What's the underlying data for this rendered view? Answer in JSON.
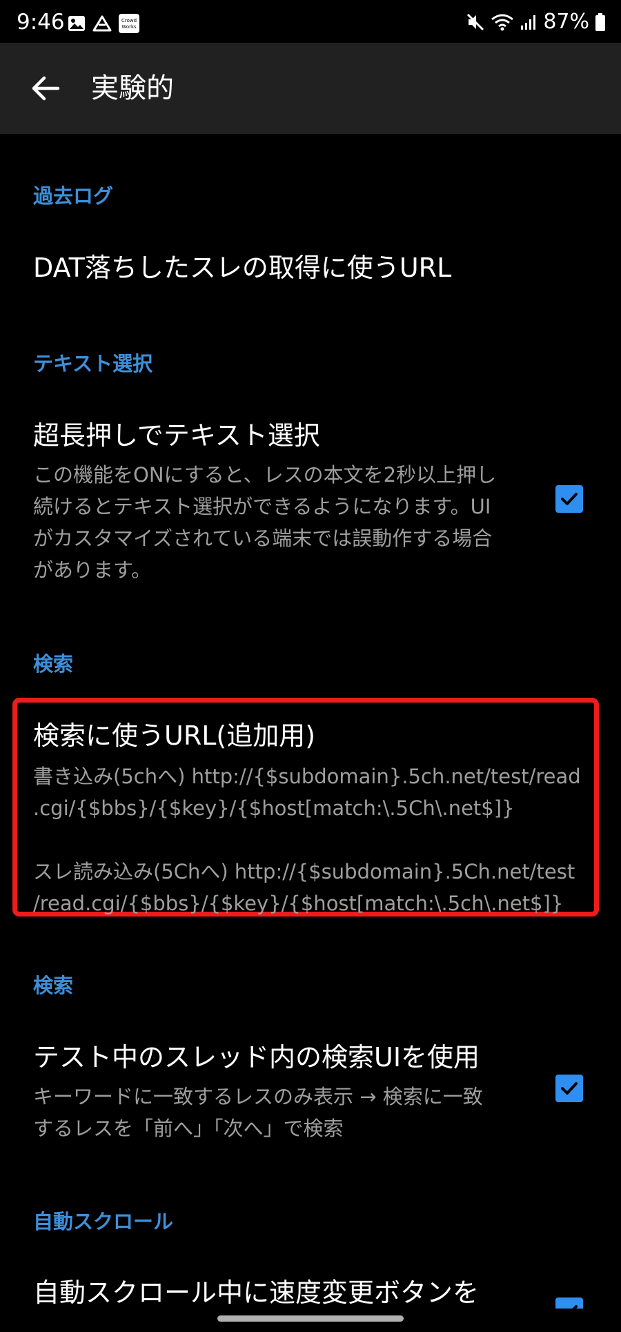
{
  "status_bar": {
    "time": "9:46",
    "left_icons": [
      "image-icon",
      "drive-icon",
      "crowdworks-icon"
    ],
    "crowdworks_label": "Crowd Works",
    "right_icons": [
      "mute-icon",
      "wifi-icon",
      "signal-icon",
      "battery-icon"
    ],
    "battery_percent": "87%"
  },
  "app_bar": {
    "back_icon": "arrow-left-icon",
    "title": "実験的"
  },
  "sections": {
    "past_log": {
      "header": "過去ログ",
      "item_title": "DAT落ちしたスレの取得に使うURL"
    },
    "text_select": {
      "header": "テキスト選択",
      "item_title": "超長押しでテキスト選択",
      "summary_lines": [
        "この機能をONにすると、レスの本文を2秒以上押し",
        "続けるとテキスト選択ができるようになります。UI",
        "がカスタマイズされている端末では誤動作する場合",
        "があります。"
      ],
      "checked": true
    },
    "search_url": {
      "header": "検索",
      "item_title": "検索に使うURL(追加用)",
      "summary_lines": [
        "書き込み(5chへ) http://{$subdomain}.5ch.net/test/read",
        ".cgi/{$bbs}/{$key}/{$host[match:\\.5Ch\\.net$]}",
        "",
        "スレ読み込み(5Chへ) http://{$subdomain}.5Ch.net/test",
        "/read.cgi/{$bbs}/{$key}/{$host[match:\\.5ch\\.net$]}"
      ],
      "highlight_color": "#ee1c1c"
    },
    "search_ui": {
      "header": "検索",
      "item_title": "テスト中のスレッド内の検索UIを使用",
      "summary_lines": [
        "キーワードに一致するレスのみ表示 → 検索に一致",
        "するレスを「前へ」「次へ」で検索"
      ],
      "checked": true
    },
    "auto_scroll": {
      "header": "自動スクロール",
      "item_title": "自動スクロール中に速度変更ボタンを",
      "checked": true
    }
  },
  "colors": {
    "accent": "#3e8fd9",
    "checkbox": "#2f8ff0",
    "app_bar": "#212121",
    "summary_text": "#9e9e9e"
  }
}
